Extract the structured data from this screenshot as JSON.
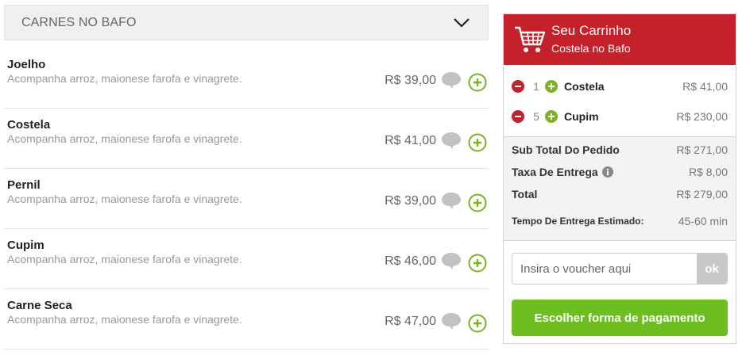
{
  "menu": {
    "category": "CARNES NO BAFO",
    "items": [
      {
        "name": "Joelho",
        "description": "Acompanha arroz, maionese farofa e vinagrete.",
        "price": "R$ 39,00"
      },
      {
        "name": "Costela",
        "description": "Acompanha arroz, maionese farofa e vinagrete.",
        "price": "R$ 41,00"
      },
      {
        "name": "Pernil",
        "description": "Acompanha arroz, maionese farofa e vinagrete.",
        "price": "R$ 39,00"
      },
      {
        "name": "Cupim",
        "description": "Acompanha arroz, maionese farofa e vinagrete.",
        "price": "R$ 46,00"
      },
      {
        "name": "Carne Seca",
        "description": "Acompanha arroz, maionese farofa e vinagrete.",
        "price": "R$ 47,00"
      }
    ]
  },
  "cart": {
    "title": "Seu Carrinho",
    "restaurant": "Costela no Bafo",
    "lines": [
      {
        "qty": "1",
        "name": "Costela",
        "price": "R$ 41,00"
      },
      {
        "qty": "5",
        "name": "Cupim",
        "price": "R$ 230,00"
      }
    ],
    "subtotal_label": "Sub Total Do Pedido",
    "subtotal": "R$ 271,00",
    "delivery_label": "Taxa De Entrega",
    "delivery": "R$ 8,00",
    "total_label": "Total",
    "total": "R$ 279,00",
    "eta_label": "Tempo De Entrega Estimado:",
    "eta": "45-60 min",
    "voucher_placeholder": "Insira o voucher aqui",
    "voucher_button": "ok",
    "pay_button": "Escolher forma de pagamento"
  },
  "colors": {
    "cart_header": "#c4212a",
    "add_green": "#7ab51d",
    "remove_red": "#c4212a",
    "pay_button": "#6cbf1e"
  },
  "icons": {
    "category_toggle": "chevron-down-icon",
    "comment": "speech-bubble-icon",
    "add": "plus-circle-icon",
    "cart": "shopping-cart-icon",
    "remove": "minus-circle-icon",
    "info": "info-icon"
  }
}
